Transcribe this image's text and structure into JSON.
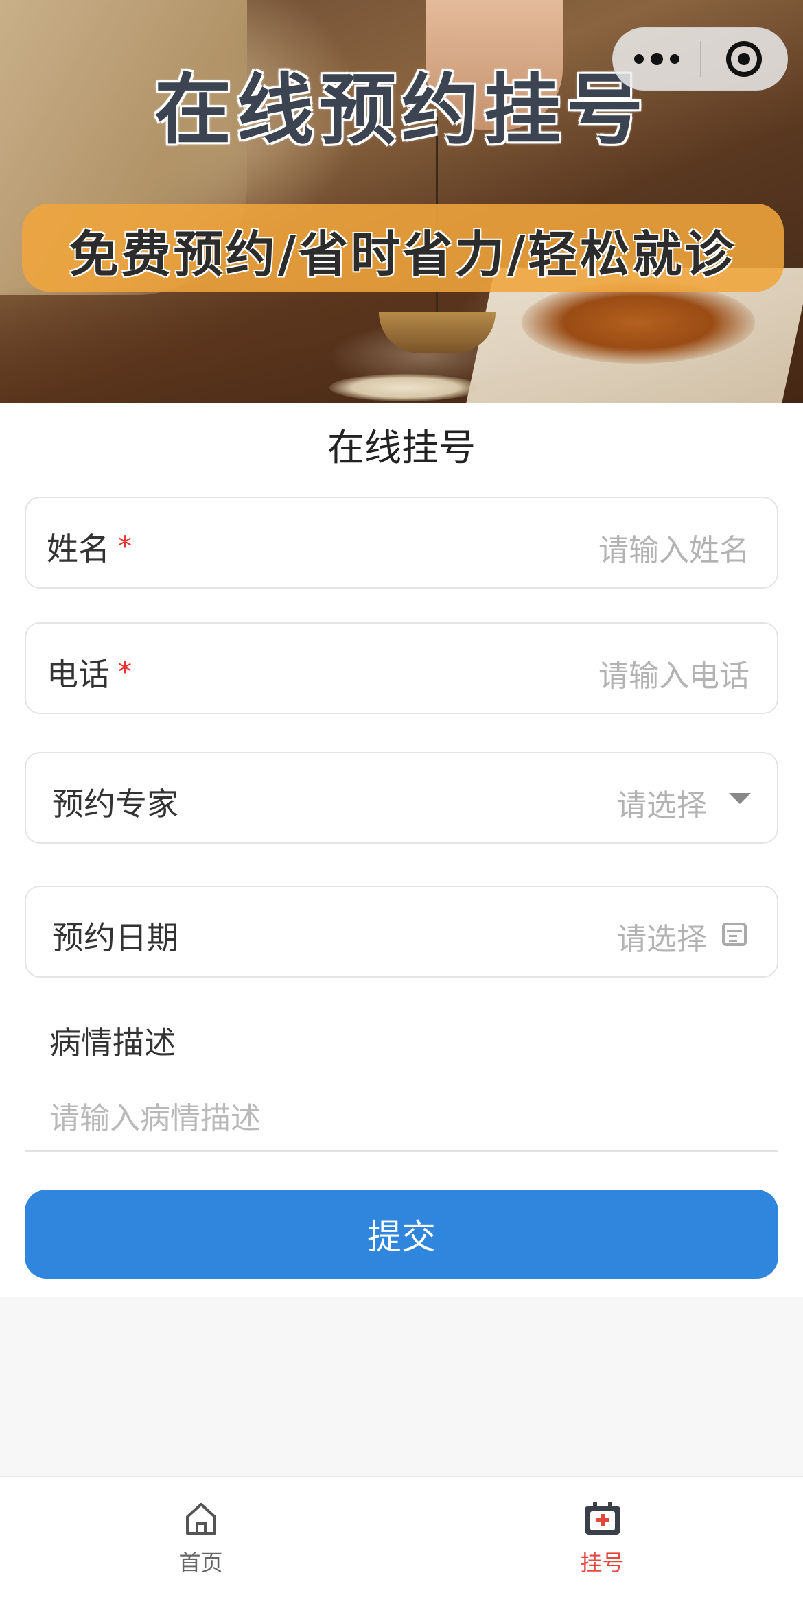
{
  "banner": {
    "title": "在线预约挂号",
    "subtitle": "免费预约/省时省力/轻松就诊"
  },
  "capsule": {
    "more_icon": "more-dots-icon",
    "close_icon": "target-close-icon"
  },
  "form": {
    "title": "在线挂号",
    "name": {
      "label": "姓名",
      "required_mark": "*",
      "placeholder": "请输入姓名"
    },
    "phone": {
      "label": "电话",
      "required_mark": "*",
      "placeholder": "请输入电话"
    },
    "expert": {
      "label": "预约专家",
      "placeholder": "请选择"
    },
    "date": {
      "label": "预约日期",
      "placeholder": "请选择"
    },
    "description": {
      "label": "病情描述",
      "placeholder": "请输入病情描述"
    },
    "submit_label": "提交"
  },
  "tabbar": {
    "items": [
      {
        "label": "首页",
        "icon": "home-icon",
        "active": false
      },
      {
        "label": "挂号",
        "icon": "medical-kit-icon",
        "active": true
      }
    ]
  },
  "colors": {
    "primary": "#2f86dc",
    "active_tab": "#e2483d",
    "required": "#ee3333",
    "banner_strip": "#f0a53c"
  }
}
